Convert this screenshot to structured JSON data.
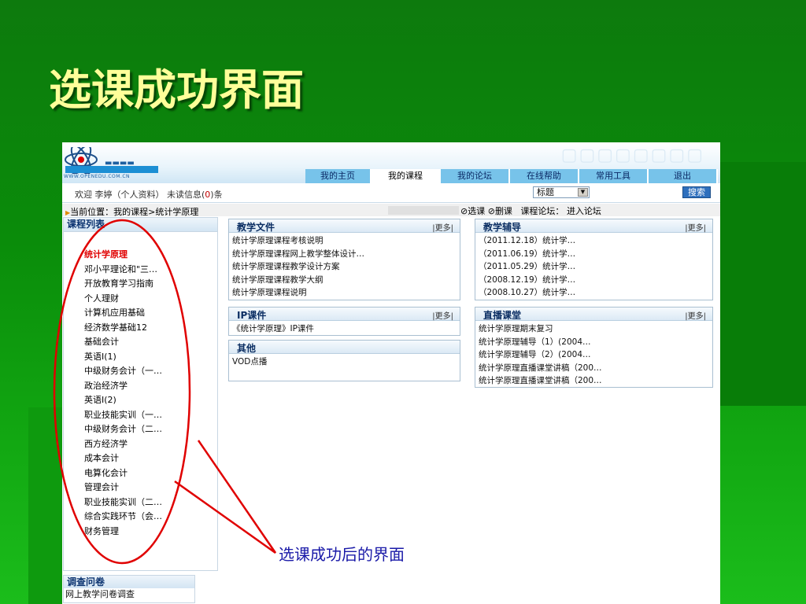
{
  "slide": {
    "title": "选课成功界面",
    "caption": "选课成功后的界面"
  },
  "logo": {
    "site": "WWW.OPENEDU.COM.CN"
  },
  "nav": {
    "tabs": [
      {
        "label": "我的主页",
        "active": false
      },
      {
        "label": "我的课程",
        "active": true
      },
      {
        "label": "我的论坛",
        "active": false
      },
      {
        "label": "在线帮助",
        "active": false
      },
      {
        "label": "常用工具",
        "active": false
      },
      {
        "label": "退出",
        "active": false
      }
    ]
  },
  "welcome": {
    "text": "欢迎 李婷（个人资料）  未读信息(",
    "unread": "0",
    "suffix": ")条",
    "select_value": "标题",
    "search_label": "搜索"
  },
  "breadcrumb": {
    "text": "当前位置：我的课程>统计学原理",
    "select_course": "选课",
    "drop_course": "删课",
    "forum_label": "课程论坛：",
    "forum_link": "进入论坛"
  },
  "sidebar": {
    "title": "课程列表",
    "current": "统计学原理",
    "courses": [
      "邓小平理论和\"三…",
      "开放教育学习指南",
      "个人理财",
      "计算机应用基础",
      "经济数学基础12",
      "基础会计",
      "英语Ⅰ(1)",
      "中级财务会计（一…",
      "政治经济学",
      "英语Ⅰ(2)",
      "职业技能实训（一…",
      "中级财务会计（二…",
      "西方经济学",
      "成本会计",
      "电算化会计",
      "管理会计",
      "职业技能实训（二…",
      "综合实践环节（会…",
      "财务管理"
    ]
  },
  "survey": {
    "title": "调查问卷",
    "item": "网上教学问卷调查"
  },
  "panels": {
    "teaching_files": {
      "title": "教学文件",
      "more": "|更多|",
      "items": [
        "统计学原理课程考核说明",
        "统计学原理课程网上教学整体设计…",
        "统计学原理课程教学设计方案",
        "统计学原理课程教学大纲",
        "统计学原理课程说明"
      ]
    },
    "tutoring": {
      "title": "教学辅导",
      "more": "|更多|",
      "items": [
        "（2011.12.18）统计学…",
        "（2011.06.19）统计学…",
        "（2011.05.29）统计学…",
        "（2008.12.19）统计学…",
        "（2008.10.27）统计学…"
      ]
    },
    "ip_courseware": {
      "title": "IP课件",
      "more": "|更多|",
      "items": [
        "《统计学原理》IP课件"
      ]
    },
    "live": {
      "title": "直播课堂",
      "more": "|更多|",
      "items": [
        "统计学原理期末复习",
        "统计学原理辅导（1）(2004…",
        "统计学原理辅导（2）(2004…",
        "统计学原理直播课堂讲稿（200…",
        "统计学原理直播课堂讲稿（200…"
      ]
    },
    "other": {
      "title": "其他",
      "items": [
        "VOD点播"
      ]
    }
  },
  "colors": {
    "nav_tab": "#77c3ea",
    "annotation": "#e00000",
    "caption": "#1a1aa8",
    "slide_title": "#ffff99"
  }
}
